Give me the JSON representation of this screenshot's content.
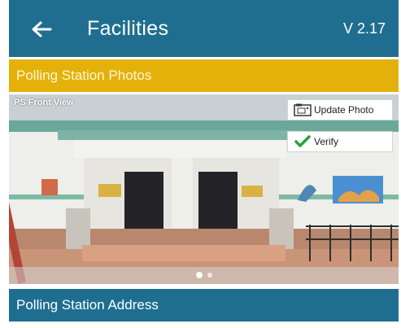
{
  "appbar": {
    "title": "Facilities",
    "version": "V 2.17",
    "back_icon": "arrow-left-icon",
    "color": "#1f6e90"
  },
  "photos_section": {
    "title": "Polling Station Photos",
    "color": "#e4b10a"
  },
  "photo": {
    "label": "PS Front View",
    "update_label": "Update Photo",
    "update_icon": "camera-photo-icon",
    "verify_label": "Verify",
    "verify_icon": "check-icon",
    "carousel_page": 1,
    "carousel_total": 2
  },
  "address_section": {
    "title": "Polling Station Address",
    "color": "#1f6e90"
  }
}
